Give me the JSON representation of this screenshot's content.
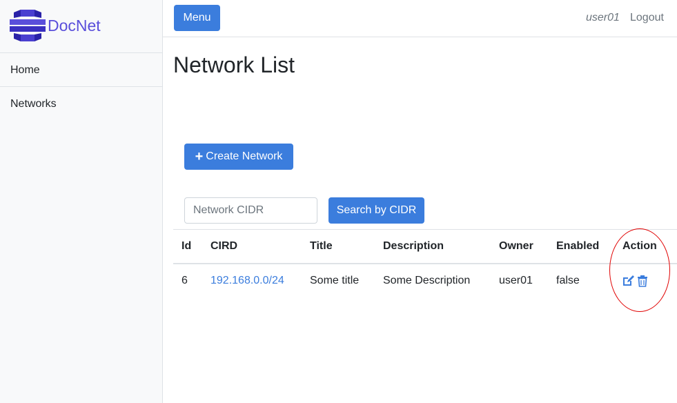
{
  "brand": {
    "name": "DocNet",
    "color": "#5a4fdb"
  },
  "sidebar": {
    "items": [
      {
        "label": "Home"
      },
      {
        "label": "Networks"
      }
    ]
  },
  "topbar": {
    "menu_label": "Menu",
    "user": "user01",
    "logout_label": "Logout"
  },
  "main": {
    "title": "Network List",
    "create_label": "Create Network",
    "search": {
      "placeholder": "Network CIDR",
      "button_label": "Search by CIDR"
    },
    "table": {
      "headers": [
        "Id",
        "CIRD",
        "Title",
        "Description",
        "Owner",
        "Enabled",
        "Action"
      ],
      "rows": [
        {
          "id": "6",
          "cidr": "192.168.0.0/24",
          "title": "Some title",
          "description": "Some Description",
          "owner": "user01",
          "enabled": "false",
          "actions": [
            "edit-icon",
            "trash-icon"
          ]
        }
      ]
    }
  },
  "colors": {
    "primary": "#3b7ddd",
    "annotation": "#e00000"
  }
}
